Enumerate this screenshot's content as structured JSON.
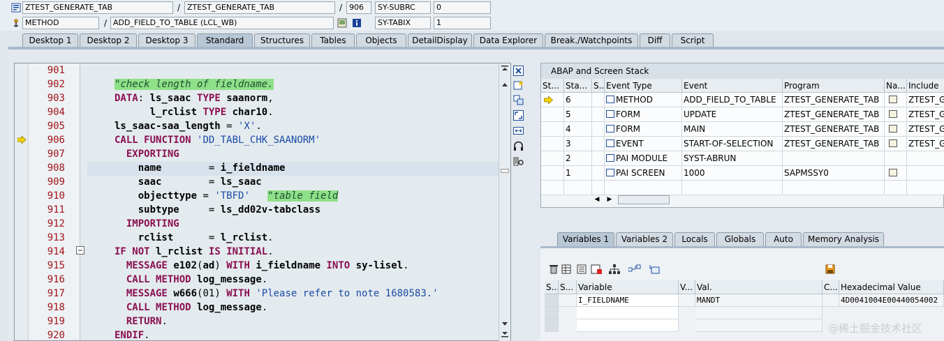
{
  "header": {
    "row1": {
      "program": "ZTEST_GENERATE_TAB",
      "include": "ZTEST_GENERATE_TAB",
      "line": "906",
      "sysvar_label": "SY-SUBRC",
      "sysvar_value": "0"
    },
    "row2": {
      "event_type": "METHOD",
      "event": "ADD_FIELD_TO_TABLE (LCL_WB)",
      "sysvar_label": "SY-TABIX",
      "sysvar_value": "1"
    },
    "separator": "/"
  },
  "desktop_tabs": [
    "Desktop 1",
    "Desktop 2",
    "Desktop 3",
    "Standard",
    "Structures",
    "Tables",
    "Objects",
    "DetailDisplay",
    "Data Explorer",
    "Break./Watchpoints",
    "Diff",
    "Script"
  ],
  "active_tab": "Standard",
  "editor": {
    "lines": [
      {
        "num": "901",
        "code": ""
      },
      {
        "num": "902",
        "code": "\"check length of fieldname."
      },
      {
        "num": "903",
        "code": "DATA: ls_saac TYPE saanorm,"
      },
      {
        "num": "904",
        "code": "      l_rclist TYPE char10."
      },
      {
        "num": "905",
        "code": "ls_saac-saa_length = 'X'."
      },
      {
        "num": "906",
        "code": "CALL FUNCTION 'DD_TABL_CHK_SAANORM'"
      },
      {
        "num": "907",
        "code": "  EXPORTING"
      },
      {
        "num": "908",
        "code": "    name        = i_fieldname"
      },
      {
        "num": "909",
        "code": "    saac        = ls_saac"
      },
      {
        "num": "910",
        "code": "    objecttype = 'TBFD'   \"table field"
      },
      {
        "num": "911",
        "code": "    subtype     = ls_dd02v-tabclass"
      },
      {
        "num": "912",
        "code": "  IMPORTING"
      },
      {
        "num": "913",
        "code": "    rclist      = l_rclist."
      },
      {
        "num": "914",
        "code": "IF NOT l_rclist IS INITIAL."
      },
      {
        "num": "915",
        "code": "  MESSAGE e102(ad) WITH i_fieldname INTO sy-lisel."
      },
      {
        "num": "916",
        "code": "  CALL METHOD log_message."
      },
      {
        "num": "917",
        "code": "  MESSAGE w666(01) WITH 'Please refer to note 1680583.'"
      },
      {
        "num": "918",
        "code": "  CALL METHOD log_message."
      },
      {
        "num": "919",
        "code": "  RETURN."
      },
      {
        "num": "920",
        "code": "ENDIF."
      }
    ],
    "current_line": "906",
    "colors": {
      "keyword": "#8a0f52",
      "string": "#1a4aa8",
      "comment_bg": "#8ee089",
      "line_number": "#a3141c"
    }
  },
  "stack": {
    "title": "ABAP and Screen Stack",
    "columns": [
      "St...",
      "Sta...",
      "S...",
      "Event Type",
      "Event",
      "Program",
      "Na...",
      "Include"
    ],
    "rows": [
      {
        "level": "6",
        "type": "METHOD",
        "event": "ADD_FIELD_TO_TABLE",
        "program": "ZTEST_GENERATE_TAB",
        "include": "ZTEST_G",
        "current": true
      },
      {
        "level": "5",
        "type": "FORM",
        "event": "UPDATE",
        "program": "ZTEST_GENERATE_TAB",
        "include": "ZTEST_G",
        "current": false
      },
      {
        "level": "4",
        "type": "FORM",
        "event": "MAIN",
        "program": "ZTEST_GENERATE_TAB",
        "include": "ZTEST_G",
        "current": false
      },
      {
        "level": "3",
        "type": "EVENT",
        "event": "START-OF-SELECTION",
        "program": "ZTEST_GENERATE_TAB",
        "include": "ZTEST_G",
        "current": false
      },
      {
        "level": "2",
        "type": "PAI MODULE",
        "event": "SYST-ABRUN",
        "program": "",
        "include": "",
        "current": false
      },
      {
        "level": "1",
        "type": "PAI SCREEN",
        "event": "1000",
        "program": "SAPMSSY0",
        "include": "",
        "current": false
      }
    ]
  },
  "variable_tabs": [
    "Variables 1",
    "Variables 2",
    "Locals",
    "Globals",
    "Auto",
    "Memory Analysis"
  ],
  "active_variable_tab": "Variables 1",
  "variables": {
    "columns": [
      "S...",
      "Variable",
      "V...",
      "Val.",
      "C...",
      "Hexadecimal Value"
    ],
    "rows": [
      {
        "name": "I_FIELDNAME",
        "value": "MANDT",
        "hex": "4D0041004E00440054002"
      }
    ]
  },
  "watermark": "@稀土掘金技术社区"
}
